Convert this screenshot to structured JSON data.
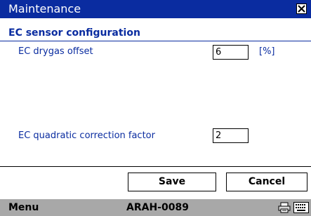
{
  "window": {
    "title": "Maintenance"
  },
  "section": {
    "title": "EC sensor configuration"
  },
  "fields": {
    "drygas_offset": {
      "label": "EC drygas offset",
      "value": "6",
      "unit": "[%]"
    },
    "quadratic_factor": {
      "label": "EC quadratic correction factor",
      "value": "2"
    }
  },
  "buttons": {
    "save_label": "Save",
    "cancel_label": "Cancel"
  },
  "menubar": {
    "menu_label": "Menu",
    "device_name": "ARAH-0089",
    "icons": [
      "printer-icon",
      "keyboard-icon"
    ]
  },
  "colors": {
    "title_bar": "#0a2ca0",
    "accent_text": "#0a2ca0",
    "menu_bar": "#a8a8a8"
  }
}
